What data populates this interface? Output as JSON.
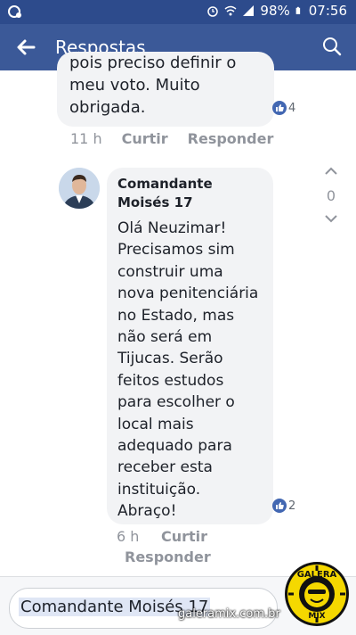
{
  "status_bar": {
    "battery": "98%",
    "time": "07:56"
  },
  "appbar": {
    "title": "Respostas"
  },
  "comment1": {
    "text": "pois preciso definir o\nmeu voto. Muito\nobrigada.",
    "reactions": "4",
    "time": "11 h",
    "like_label": "Curtir",
    "reply_label": "Responder"
  },
  "comment2": {
    "author": "Comandante Moisés 17",
    "text": "Olá Neuzimar!\nPrecisamos sim\nconstruir uma\nnova penitenciária\nno Estado, mas\nnão será em\nTijucas. Serão\nfeitos estudos\npara escolher o\nlocal mais\nadequado para\nreceber esta\ninstituição.\nAbraço!",
    "reactions": "2",
    "votes": "0",
    "time": "6 h",
    "like_label": "Curtir",
    "reply_label": "Responder"
  },
  "composer": {
    "mention": "Comandante Moisés 17"
  },
  "watermark": {
    "site": "galeramix.com.br",
    "logo_top": "GALERA",
    "logo_bottom": "MIX"
  },
  "colors": {
    "appbar": "#3b5998",
    "statusbar": "#2d4b8c",
    "bubble": "#f2f3f5",
    "like_blue": "#4267b2"
  }
}
